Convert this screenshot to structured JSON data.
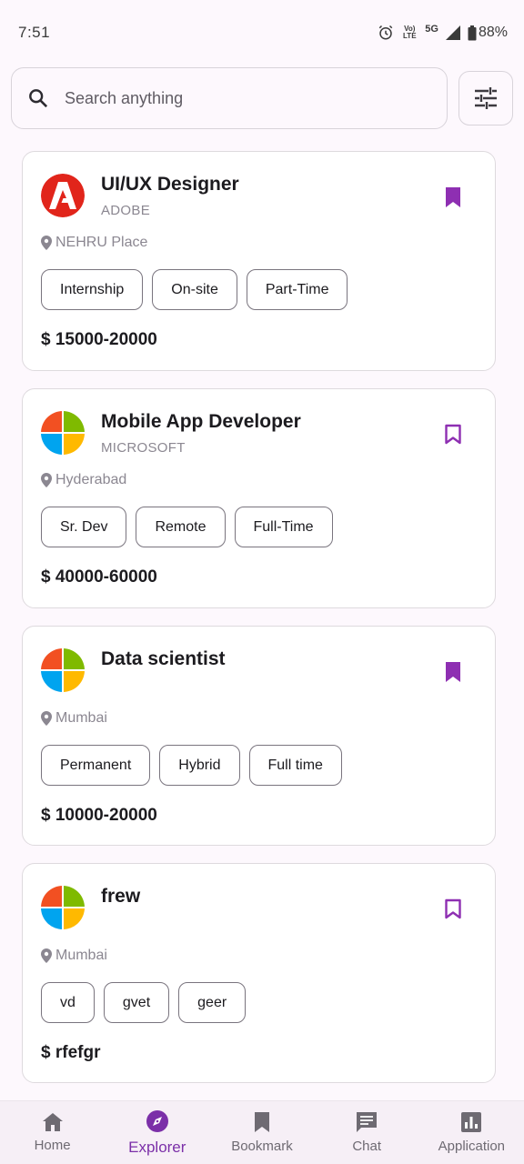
{
  "status": {
    "time": "7:51",
    "battery": "88%",
    "net": "Vo) LTE",
    "signal": "5G"
  },
  "search": {
    "placeholder": "Search anything"
  },
  "jobs": [
    {
      "title": "UI/UX Designer",
      "company": "ADOBE",
      "location": "NEHRU Place",
      "tags": [
        "Internship",
        "On-site",
        "Part-Time"
      ],
      "salary": "$ 15000-20000",
      "bookmarked": true,
      "logo": "adobe-logo"
    },
    {
      "title": "Mobile App Developer",
      "company": "MICROSOFT",
      "location": "Hyderabad",
      "tags": [
        "Sr. Dev",
        "Remote",
        "Full-Time"
      ],
      "salary": "$ 40000-60000",
      "bookmarked": false,
      "logo": "microsoft-logo"
    },
    {
      "title": "Data scientist",
      "company": "",
      "location": "Mumbai",
      "tags": [
        "Permanent",
        "Hybrid",
        "Full time"
      ],
      "salary": "$ 10000-20000",
      "bookmarked": true,
      "logo": "microsoft-logo"
    },
    {
      "title": "frew",
      "company": "",
      "location": "Mumbai",
      "tags": [
        "vd",
        "gvet",
        "geer"
      ],
      "salary": "$ rfefgr",
      "bookmarked": false,
      "logo": "microsoft-logo"
    }
  ],
  "nav": [
    {
      "label": "Home",
      "icon": "home-icon",
      "active": false
    },
    {
      "label": "Explorer",
      "icon": "compass-icon",
      "active": true
    },
    {
      "label": "Bookmark",
      "icon": "bookmark-icon",
      "active": false
    },
    {
      "label": "Chat",
      "icon": "chat-icon",
      "active": false
    },
    {
      "label": "Application",
      "icon": "bar-chart-icon",
      "active": false
    }
  ],
  "colors": {
    "accent": "#8e2fb2",
    "background": "#fdf8fd",
    "adobe_red": "#e1251b"
  }
}
